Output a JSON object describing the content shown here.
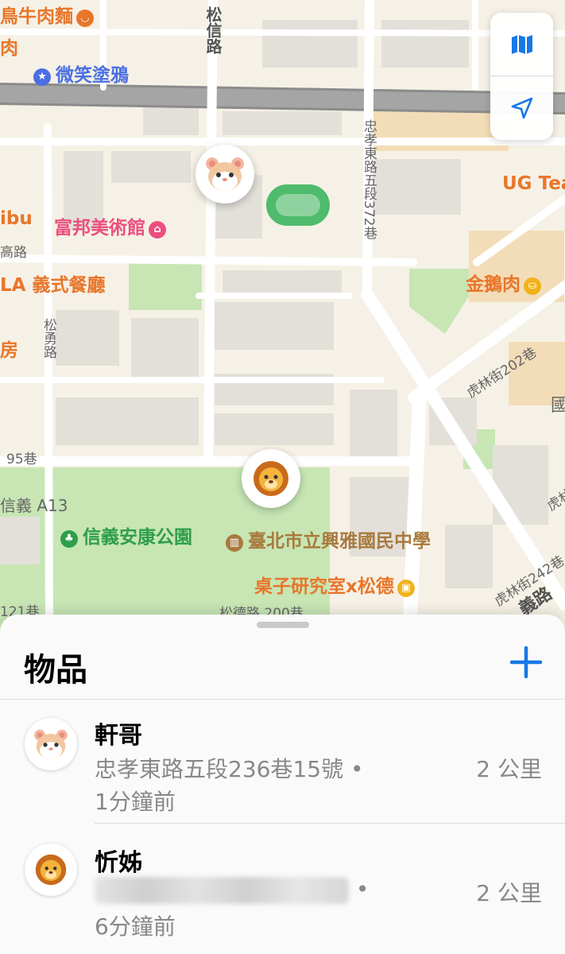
{
  "map": {
    "pois": [
      {
        "text": "鳥牛肉麵",
        "color": "#e8762a"
      },
      {
        "text": "肉",
        "color": "#e8762a"
      },
      {
        "text": "微笑塗鴉",
        "color": "#4b6fe3"
      },
      {
        "text": "富邦美術館",
        "color": "#ec4f7f"
      },
      {
        "text": "LA 義式餐廳",
        "color": "#e8762a"
      },
      {
        "text": "UG Tea",
        "color": "#e8762a"
      },
      {
        "text": "金鵝肉",
        "color": "#e8762a"
      },
      {
        "text": "信義安康公園",
        "color": "#2f9e4a"
      },
      {
        "text": "臺北市立興雅國民中學",
        "color": "#a97a3e"
      },
      {
        "text": "桌子研究室x松德",
        "color": "#e8762a"
      },
      {
        "text": "ibu",
        "color": "#e8762a"
      },
      {
        "text": "房",
        "color": "#e8762a"
      }
    ],
    "roads": {
      "songxin": "松信路",
      "songyong": "松勇路",
      "zhongxiao": "忠孝東路五段372巷",
      "hulin202": "虎林街202巷",
      "hulin242": "虎林街242巷",
      "hulin": "虎林",
      "lane95": "95巷",
      "lane121": "121巷",
      "gaolu": "高路",
      "xinyi_a13": "信義 A13",
      "guo": "國",
      "lane_bottom": "松德路 200巷",
      "xinyilu": "義路"
    },
    "pins": [
      {
        "name": "hamster",
        "emoji": "🐹"
      },
      {
        "name": "lion",
        "emoji": "🦁"
      }
    ]
  },
  "map_controls": {
    "map_icon": "map-icon",
    "location_icon": "location-arrow-icon",
    "accent": "#1877e6"
  },
  "sheet": {
    "title": "物品",
    "add_label": "+",
    "items": [
      {
        "name": "軒哥",
        "emoji": "🐹",
        "address": "忠孝東路五段236巷15號 •",
        "time": "1分鐘前",
        "distance": "2 公里"
      },
      {
        "name": "忻姊",
        "emoji": "🦁",
        "address": "•",
        "time": "6分鐘前",
        "distance": "2 公里"
      }
    ]
  }
}
